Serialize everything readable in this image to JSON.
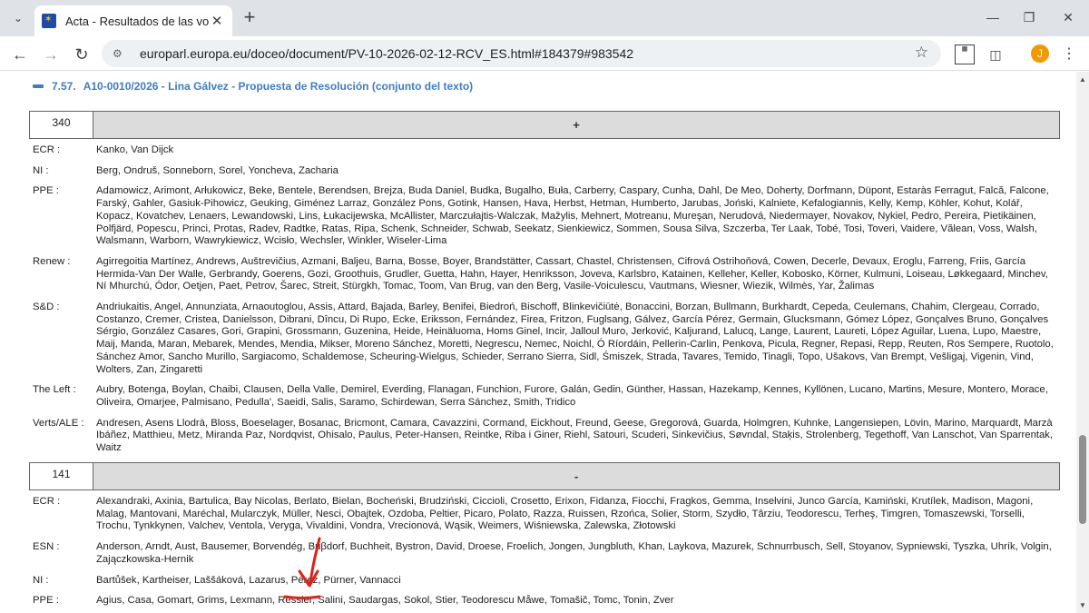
{
  "browser": {
    "tab_title": "Acta - Resultados de las votacio",
    "tab_close": "✕",
    "new_tab": "+",
    "url": "europarl.europa.eu/doceo/document/PV-10-2026-02-12-RCV_ES.html#184379#983542",
    "avatar_letter": "J",
    "icons": [
      "tab-search-icon",
      "close-icon",
      "plus-icon",
      "minimize-icon",
      "maximize-icon",
      "close-window-icon",
      "back-icon",
      "forward-icon",
      "reload-icon",
      "site-settings-icon",
      "star-icon",
      "qr-icon",
      "extensions-icon",
      "menu-icon"
    ]
  },
  "section": {
    "number": "7.57.",
    "title": "A10-0010/2026 - Lina Gálvez - Propuesta de Resolución (conjunto del texto)"
  },
  "votes": [
    {
      "count": "340",
      "sign": "+",
      "groups": [
        {
          "label": "ECR :",
          "names": "Kanko, Van Dijck"
        },
        {
          "label": "NI :",
          "names": "Berg, Ondruš, Sonneborn, Sorel, Yoncheva, Zacharia"
        },
        {
          "label": "PPE :",
          "names": "Adamowicz, Arimont, Arłukowicz, Beke, Bentele, Berendsen, Brejza, Buda Daniel, Budka, Bugalho, Buła, Carberry, Caspary, Cunha, Dahl, De Meo, Doherty, Dorfmann, Düpont, Estaràs Ferragut, Falcă, Falcone, Farský, Gahler, Gasiuk-Pihowicz, Geuking, Giménez Larraz, González Pons, Gotink, Hansen, Hava, Herbst, Hetman, Humberto, Jarubas, Joński, Kalniete, Kefalogiannis, Kelly, Kemp, Köhler, Kohut, Kolář, Kopacz, Kovatchev, Lenaers, Lewandowski, Lins, Łukacijewska, McAllister, Marczułajtis-Walczak, Mažylis, Mehnert, Motreanu, Mureşan, Nerudová, Niedermayer, Novakov, Nykiel, Pedro, Pereira, Pietikäinen, Polfjärd, Popescu, Princi, Protas, Radev, Radtke, Ratas, Ripa, Schenk, Schneider, Schwab, Seekatz, Sienkiewicz, Sommen, Sousa Silva, Szczerba, Ter Laak, Tobé, Tosi, Toveri, Vaidere, Vălean, Voss, Walsh, Walsmann, Warborn, Wawrykiewicz, Wcisło, Wechsler, Winkler, Wiseler-Lima"
        },
        {
          "label": "Renew :",
          "names": "Agirregoitia Martínez, Andrews, Auštrevičius, Azmani, Baljeu, Barna, Bosse, Boyer, Brandstätter, Cassart, Chastel, Christensen, Cifrová Ostrihoňová, Cowen, Decerle, Devaux, Eroglu, Farreng, Friis, García Hermida-Van Der Walle, Gerbrandy, Goerens, Gozi, Groothuis, Grudler, Guetta, Hahn, Hayer, Henriksson, Joveva, Karlsbro, Katainen, Kelleher, Keller, Kobosko, Körner, Kulmuni, Loiseau, Løkkegaard, Minchev, Ní Mhurchú, Ódor, Oetjen, Paet, Petrov, Šarec, Streit, Stürgkh, Tomac, Toom, Van Brug, van den Berg, Vasile-Voiculescu, Vautmans, Wiesner, Wiezik, Wilmès, Yar, Žalimas"
        },
        {
          "label": "S&D :",
          "names": "Andriukaitis, Angel, Annunziata, Arnaoutoglou, Assis, Attard, Bajada, Barley, Benifei, Biedroń, Bischoff, Blinkevičiūtė, Bonaccini, Borzan, Bullmann, Burkhardt, Cepeda, Ceulemans, Chahim, Clergeau, Corrado, Costanzo, Cremer, Cristea, Danielsson, Dibrani, Dîncu, Di Rupo, Ecke, Eriksson, Fernández, Firea, Fritzon, Fuglsang, Gálvez, García Pérez, Germain, Glucksmann, Gómez López, Gonçalves Bruno, Gonçalves Sérgio, González Casares, Gori, Grapini, Grossmann, Guzenina, Heide, Heinäluoma, Homs Ginel, Incir, Jalloul Muro, Jerković, Kaljurand, Lalucq, Lange, Laurent, Laureti, López Aguilar, Luena, Lupo, Maestre, Maij, Manda, Maran, Mebarek, Mendes, Mendia, Mikser, Moreno Sánchez, Moretti, Negrescu, Nemec, Noichl, Ó Ríordáin, Pellerin-Carlin, Penkova, Picula, Regner, Repasi, Repp, Reuten, Ros Sempere, Ruotolo, Sánchez Amor, Sancho Murillo, Sargiacomo, Schaldemose, Scheuring-Wielgus, Schieder, Serrano Sierra, Sidl, Śmiszek, Strada, Tavares, Temido, Tinagli, Topo, Ušakovs, Van Brempt, Vešligaj, Vigenin, Vind, Wolters, Zan, Zingaretti"
        },
        {
          "label": "The Left :",
          "names": "Aubry, Botenga, Boylan, Chaibi, Clausen, Della Valle, Demirel, Everding, Flanagan, Funchion, Furore, Galán, Gedin, Günther, Hassan, Hazekamp, Kennes, Kyllönen, Lucano, Martins, Mesure, Montero, Morace, Oliveira, Omarjee, Palmisano, Pedulla', Saeidi, Salis, Saramo, Schirdewan, Serra Sánchez, Smith, Tridico"
        },
        {
          "label": "Verts/ALE :",
          "names": "Andresen, Asens Llodrà, Bloss, Boeselager, Bosanac, Bricmont, Camara, Cavazzini, Cormand, Eickhout, Freund, Geese, Gregorová, Guarda, Holmgren, Kuhnke, Langensiepen, Lövin, Marino, Marquardt, Marzà Ibáñez, Matthieu, Metz, Miranda Paz, Nordqvist, Ohisalo, Paulus, Peter-Hansen, Reintke, Riba i Giner, Riehl, Satouri, Scuderi, Sinkevičius, Søvndal, Staķis, Strolenberg, Tegethoff, Van Lanschot, Van Sparrentak, Waitz"
        }
      ]
    },
    {
      "count": "141",
      "sign": "-",
      "groups": [
        {
          "label": "ECR :",
          "names": "Alexandraki, Axinia, Bartulica, Bay Nicolas, Berlato, Bielan, Bocheński, Brudziński, Ciccioli, Crosetto, Erixon, Fidanza, Fiocchi, Fragkos, Gemma, Inselvini, Junco García, Kamiński, Krutílek, Madison, Magoni, Malag, Mantovani, Maréchal, Mularczyk, Müller, Nesci, Obajtek, Ozdoba, Peltier, Picaro, Polato, Razza, Ruissen, Rzońca, Solier, Storm, Szydło, Târziu, Teodorescu, Terheş, Timgren, Tomaszewski, Torselli, Trochu, Tynkkynen, Valchev, Ventola, Veryga, Vivaldini, Vondra, Vrecionová, Wąsik, Weimers, Wiśniewska, Zalewska, Złotowski"
        },
        {
          "label": "ESN :",
          "names": "Anderson, Arndt, Aust, Bausemer, Borvendég, Buβdorf, Buchheit, Bystron, David, Droese, Froelich, Jongen, Jungbluth, Khan, Laykova, Mazurek, Schnurrbusch, Sell, Stoyanov, Sypniewski, Tyszka, Uhrík, Volgin, Zajączkowska-Hernik"
        },
        {
          "label": "NI :",
          "names": "Bartůšek, Kartheiser, Laššáková, Lazarus, Pérez, Pürner, Vannacci"
        },
        {
          "label": "PPE :",
          "names": "Agius, Casa, Gomart, Grims, Lexmann, Ressler, Salini, Saudargas, Sokol, Stier, Teodorescu Måwe, Tomašič, Tomc, Tonin, Zver"
        }
      ]
    }
  ],
  "annotation_color": "#e0201b"
}
